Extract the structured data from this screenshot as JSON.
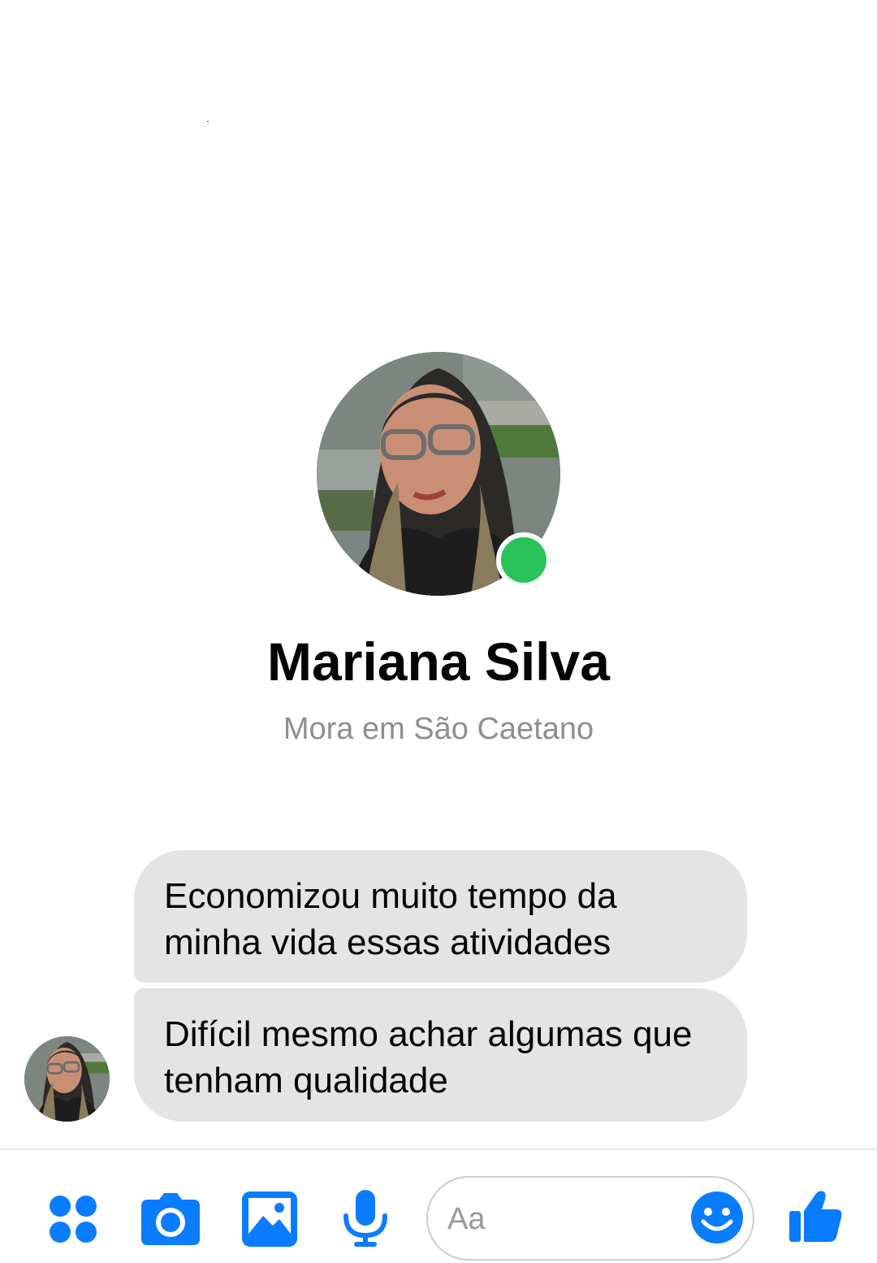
{
  "profile": {
    "name": "Mariana Silva",
    "subtitle": "Mora em São Caetano",
    "online": true
  },
  "messages": [
    {
      "text": "Economizou muito tempo da minha vida essas atividades"
    },
    {
      "text": "Difícil mesmo achar algumas que tenham qualidade"
    }
  ],
  "composer": {
    "placeholder": "Aa",
    "value": "",
    "icons": [
      "more-apps-icon",
      "camera-icon",
      "gallery-icon",
      "microphone-icon",
      "emoji-icon",
      "thumbs-up-icon"
    ]
  },
  "colors": {
    "accent": "#0a7cff",
    "online": "#2ac35a",
    "bubble": "#e4e4e4"
  }
}
